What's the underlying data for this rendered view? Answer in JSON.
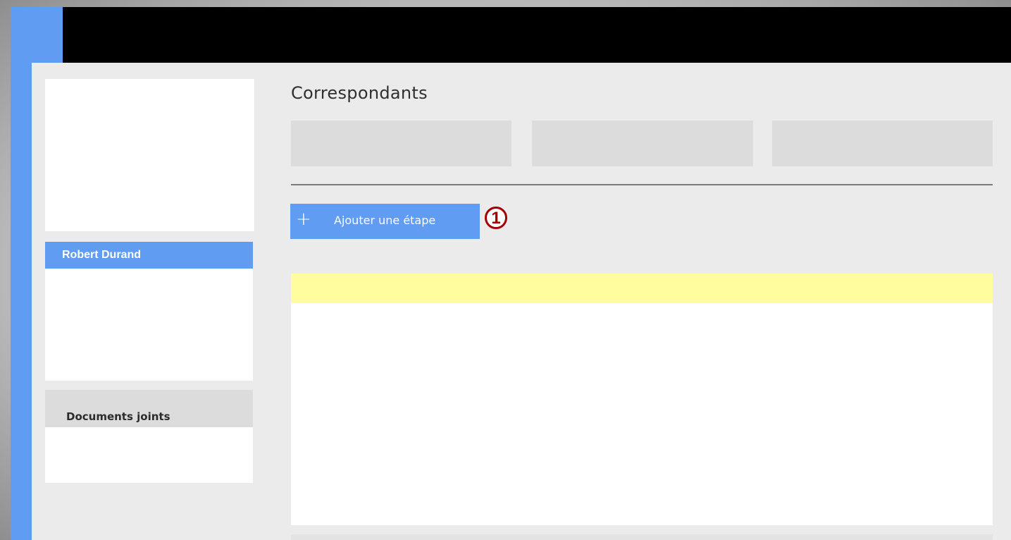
{
  "main": {
    "page_title": "Correspondants",
    "add_step_label": "Ajouter une étape",
    "add_icon": "+",
    "callout_number": "1"
  },
  "sidebar": {
    "contact_name": "Robert Durand",
    "documents_title": "Documents joints"
  },
  "colors": {
    "accent": "#5f9cf2",
    "top_bar": "#000000",
    "highlight": "#fffd9d",
    "callout": "#a20000"
  }
}
